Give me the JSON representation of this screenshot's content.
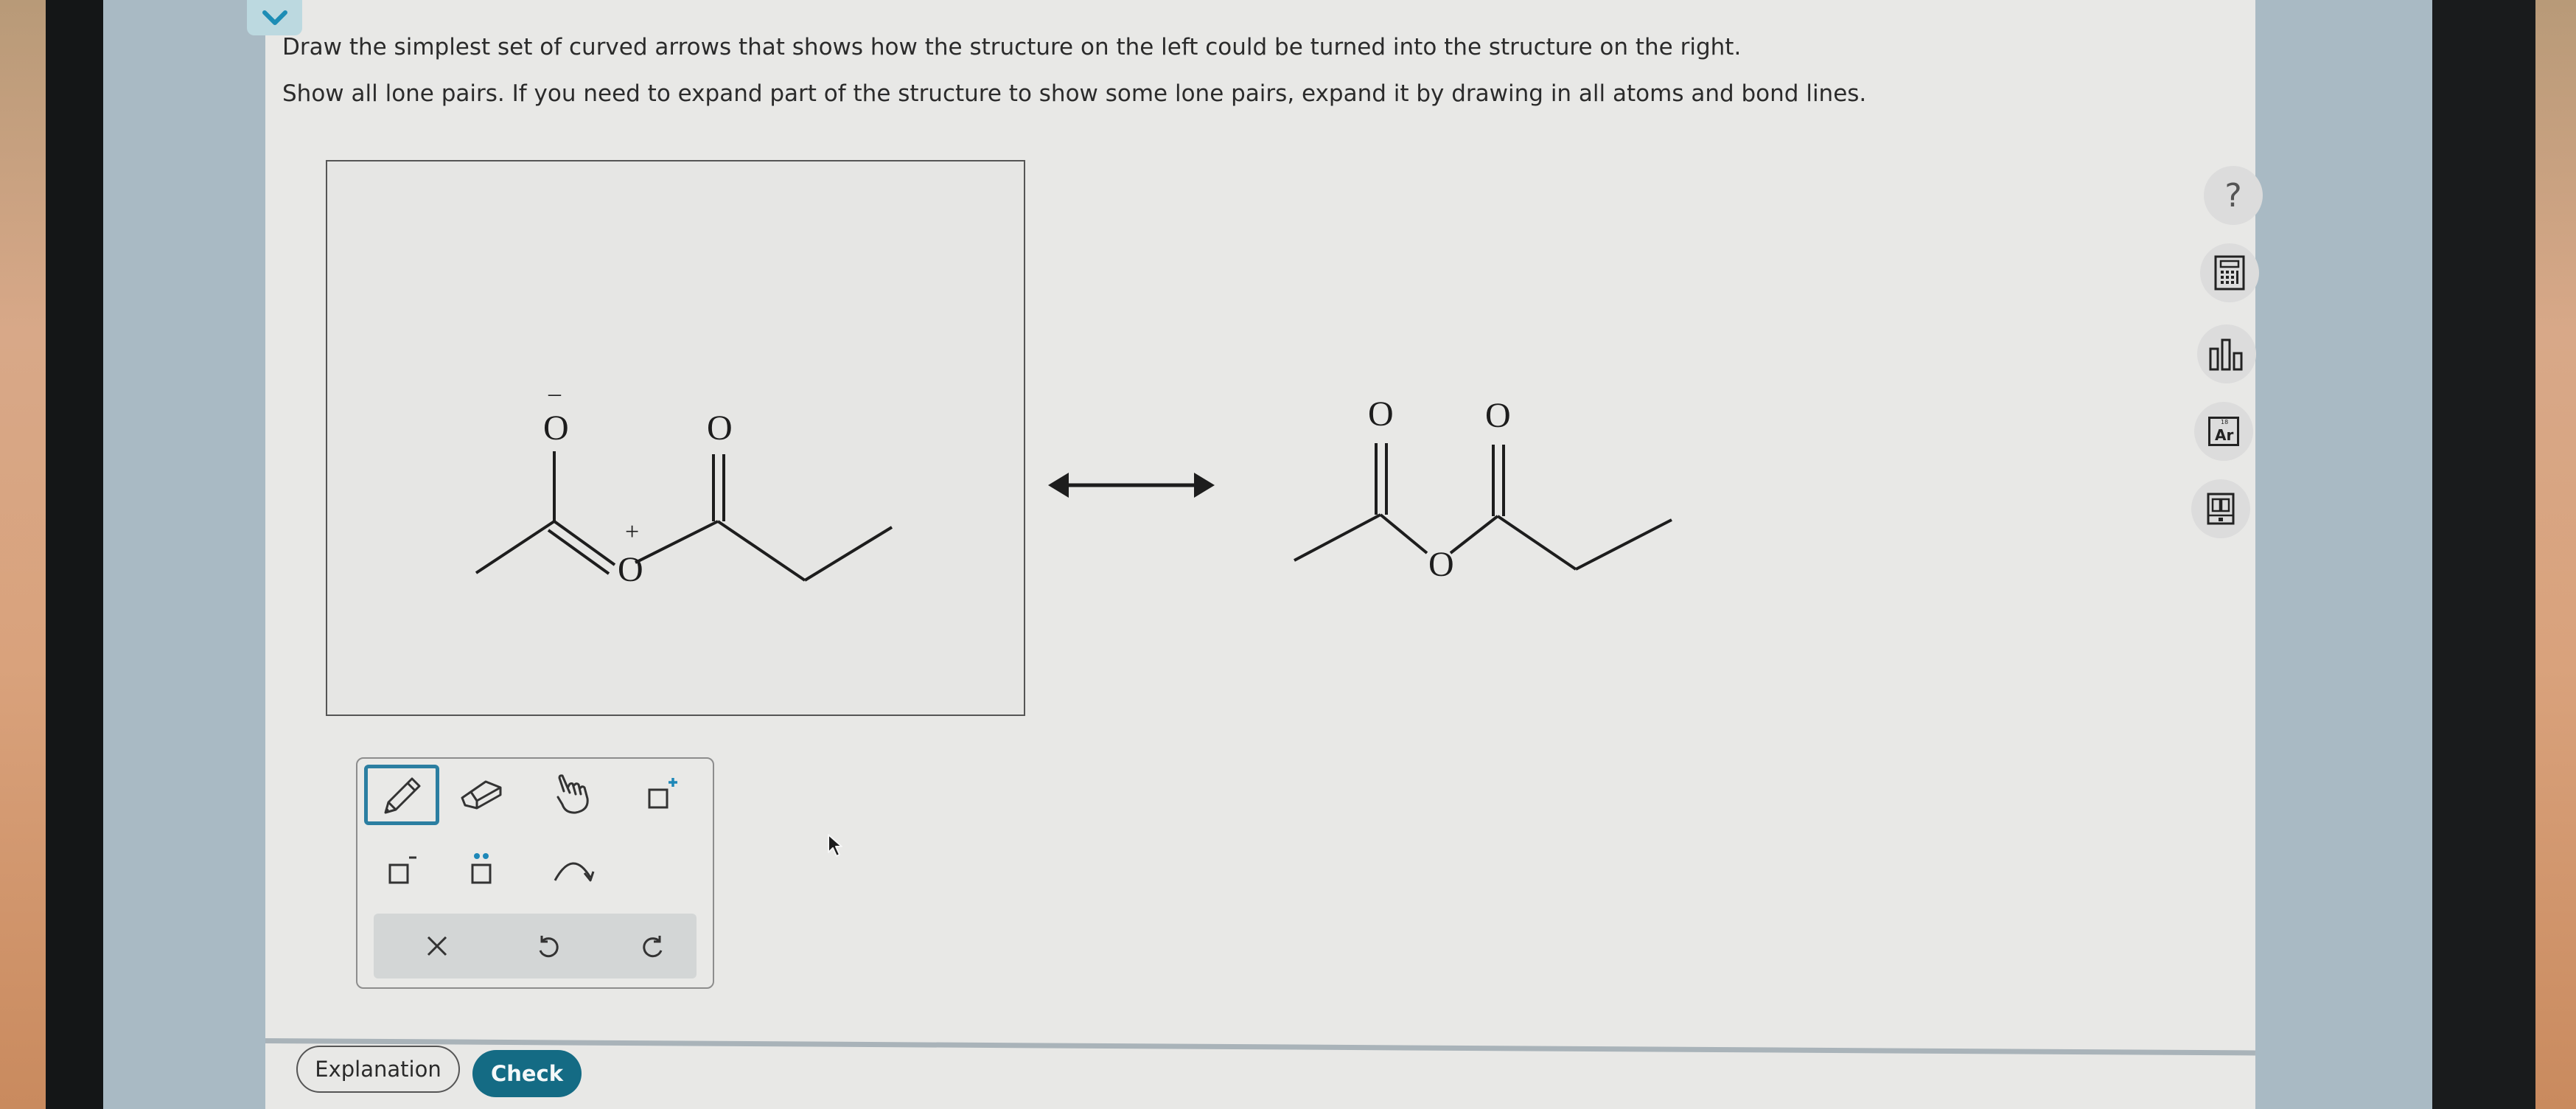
{
  "colors": {
    "accent": "#2b7ea1",
    "check_button": "#146b84",
    "collapse_tab": "#bcd9e0",
    "content_bg": "#e8e8e6"
  },
  "header": {
    "collapse_icon": "chevron-down-icon"
  },
  "instructions": {
    "line1": "Draw the simplest set of curved arrows that shows how the structure on the left could be turned into the structure on the right.",
    "line2": "Show all lone pairs. If you need to expand part of the structure to show some lone pairs, expand it by drawing in all atoms and bond lines."
  },
  "reactant": {
    "atoms": {
      "o_top_left": "O",
      "o_top_right": "O",
      "o_bridge": "O"
    },
    "charges": {
      "negative": "–",
      "positive": "+"
    }
  },
  "resonance_arrow": "double-headed-arrow",
  "product": {
    "atoms": {
      "o_top_left": "O",
      "o_top_right": "O",
      "o_bridge": "O"
    }
  },
  "toolbar": {
    "tools": [
      {
        "name": "pencil",
        "icon": "pencil-icon",
        "active": true
      },
      {
        "name": "eraser",
        "icon": "eraser-icon",
        "active": false
      },
      {
        "name": "move",
        "icon": "hand-icon",
        "active": false
      },
      {
        "name": "add-positive-charge",
        "icon": "positive-charge-icon",
        "active": false
      },
      {
        "name": "add-negative-charge",
        "icon": "negative-charge-icon",
        "active": false
      },
      {
        "name": "add-lone-pair",
        "icon": "lone-pair-icon",
        "active": false
      },
      {
        "name": "curved-arrow",
        "icon": "curved-arrow-icon",
        "active": false
      }
    ],
    "actions": [
      {
        "name": "clear",
        "icon": "close-icon"
      },
      {
        "name": "undo",
        "icon": "undo-icon"
      },
      {
        "name": "redo",
        "icon": "redo-icon"
      }
    ]
  },
  "side_tools": [
    {
      "name": "help",
      "icon": "help-icon",
      "glyph": "?"
    },
    {
      "name": "calculator",
      "icon": "calculator-icon"
    },
    {
      "name": "data",
      "icon": "bar-chart-icon"
    },
    {
      "name": "periodic-table",
      "icon": "periodic-table-icon",
      "element_number": "18",
      "element_symbol": "Ar"
    },
    {
      "name": "ebook",
      "icon": "book-icon"
    }
  ],
  "footer": {
    "explanation_label": "Explanation",
    "check_label": "Check"
  }
}
